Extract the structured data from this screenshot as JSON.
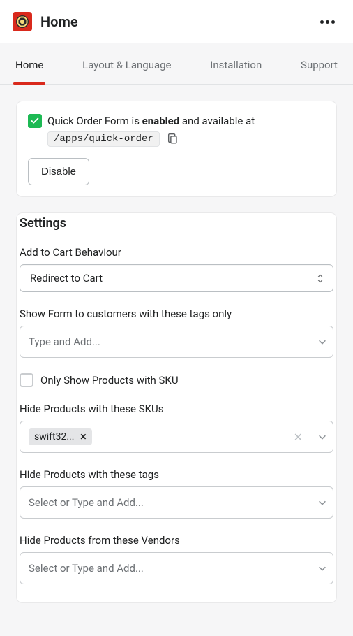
{
  "header": {
    "title": "Home"
  },
  "tabs": [
    {
      "label": "Home",
      "active": true
    },
    {
      "label": "Layout & Language",
      "active": false
    },
    {
      "label": "Installation",
      "active": false
    },
    {
      "label": "Support",
      "active": false
    }
  ],
  "status": {
    "prefix": "Quick Order Form is ",
    "bold": "enabled",
    "suffix": " and available at",
    "path": "/apps/quick-order",
    "disable_btn": "Disable"
  },
  "settings": {
    "title": "Settings",
    "cart": {
      "label": "Add to Cart Behaviour",
      "value": "Redirect to Cart"
    },
    "show_tags": {
      "label": "Show Form to customers with these tags only",
      "placeholder": "Type and Add..."
    },
    "sku_checkbox": {
      "label": "Only Show Products with SKU",
      "checked": false
    },
    "hide_skus": {
      "label": "Hide Products with these SKUs",
      "chips": [
        "swift32..."
      ]
    },
    "hide_tags": {
      "label": "Hide Products with these tags",
      "placeholder": "Select or Type and Add..."
    },
    "hide_vendors": {
      "label": "Hide Products from these Vendors",
      "placeholder": "Select or Type and Add..."
    }
  }
}
